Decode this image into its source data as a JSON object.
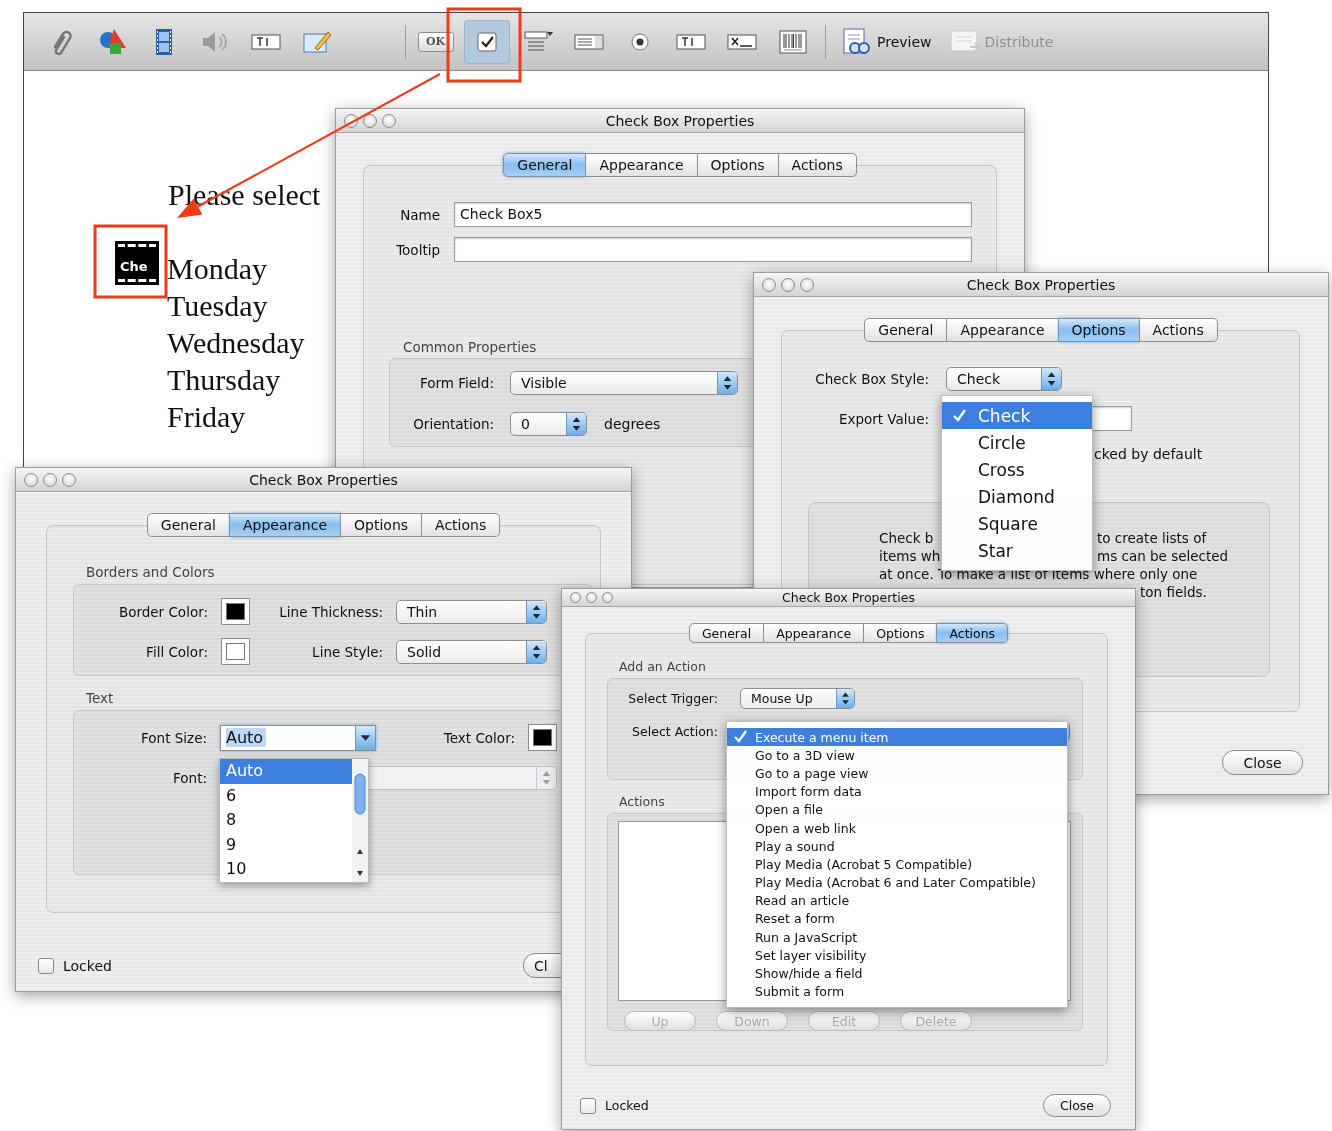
{
  "toolbar": {
    "tool_groups": [
      {
        "tools": [
          {
            "selected": false
          },
          {
            "selected": false
          },
          {
            "selected": false
          },
          {
            "selected": false
          },
          {
            "selected": false
          },
          {
            "selected": false
          }
        ]
      },
      {
        "tools": [
          {
            "label": "OK",
            "selected": false
          },
          {
            "selected": true
          },
          {
            "selected": false
          },
          {
            "selected": false
          },
          {
            "selected": false
          },
          {
            "selected": false
          },
          {
            "selected": false
          },
          {
            "selected": false
          }
        ]
      }
    ],
    "buttons": [
      {
        "label": "Preview",
        "disabled": false
      },
      {
        "label": "Distribute",
        "disabled": true
      }
    ]
  },
  "document": {
    "prompt": "Please select",
    "field_label": "Che",
    "days": [
      "Monday",
      "Tuesday",
      "Wednesday",
      "Thursday",
      "Friday"
    ]
  },
  "windows": [
    {
      "kind": "general",
      "title": "Check Box Properties",
      "tabs": [
        {
          "label": "General",
          "selected": true
        },
        {
          "label": "Appearance",
          "selected": false
        },
        {
          "label": "Options",
          "selected": false
        },
        {
          "label": "Actions",
          "selected": false
        }
      ],
      "name_label": "Name",
      "name_value": "Check Box5",
      "tooltip_label": "Tooltip",
      "common": {
        "title": "Common Properties",
        "form_field_label": "Form Field:",
        "form_field_value": "Visible",
        "orientation_label": "Orientation:",
        "orientation_value": "0",
        "orientation_unit": "degrees"
      }
    },
    {
      "kind": "options",
      "title": "Check Box Properties",
      "tabs": [
        {
          "label": "General",
          "selected": false
        },
        {
          "label": "Appearance",
          "selected": false
        },
        {
          "label": "Options",
          "selected": true
        },
        {
          "label": "Actions",
          "selected": false
        }
      ],
      "style_label": "Check Box Style:",
      "style_value": "Check",
      "export_label": "Export Value:",
      "default_text": "cked by default",
      "description_lines": [
        {
          "left": "Check b",
          "right": "to create lists of"
        },
        {
          "left": "items wh",
          "right": "ms can be selected"
        },
        {
          "full": "at once. To make a list of items where only one"
        },
        {
          "right": "ton fields."
        }
      ],
      "close_button": "Close",
      "style_menu": [
        {
          "label": "Check",
          "selected": true
        },
        {
          "label": "Circle",
          "selected": false
        },
        {
          "label": "Cross",
          "selected": false
        },
        {
          "label": "Diamond",
          "selected": false
        },
        {
          "label": "Square",
          "selected": false
        },
        {
          "label": "Star",
          "selected": false
        }
      ]
    },
    {
      "kind": "appearance",
      "title": "Check Box Properties",
      "tabs": [
        {
          "label": "General",
          "selected": false
        },
        {
          "label": "Appearance",
          "selected": true
        },
        {
          "label": "Options",
          "selected": false
        },
        {
          "label": "Actions",
          "selected": false
        }
      ],
      "borders": {
        "title": "Borders and Colors",
        "border_color_label": "Border Color:",
        "border_swatch": {
          "color": "#000000"
        },
        "line_thickness_label": "Line Thickness:",
        "line_thickness_value": "Thin",
        "fill_color_label": "Fill Color:",
        "fill_swatch": {
          "color": "#ffffff"
        },
        "line_style_label": "Line Style:",
        "line_style_value": "Solid"
      },
      "text": {
        "title": "Text",
        "font_size_label": "Font Size:",
        "font_size_value": "Auto",
        "text_color_label": "Text Color:",
        "text_swatch": {
          "color": "#000000"
        },
        "font_label": "Font:"
      },
      "font_size_menu": [
        {
          "label": "Auto",
          "selected": true
        },
        {
          "label": "6",
          "selected": false
        },
        {
          "label": "8",
          "selected": false
        },
        {
          "label": "9",
          "selected": false
        },
        {
          "label": "10",
          "selected": false
        }
      ],
      "locked": {
        "label": "Locked",
        "checked": false
      },
      "close_button": "Cl"
    },
    {
      "kind": "actions",
      "title": "Check Box Properties",
      "tabs": [
        {
          "label": "General",
          "selected": false
        },
        {
          "label": "Appearance",
          "selected": false
        },
        {
          "label": "Options",
          "selected": false
        },
        {
          "label": "Actions",
          "selected": true
        }
      ],
      "add": {
        "title": "Add an Action",
        "trigger_label": "Select Trigger:",
        "trigger_value": "Mouse Up",
        "action_label": "Select Action:"
      },
      "action_menu": [
        {
          "label": "Execute a menu item",
          "selected": true
        },
        {
          "label": "Go to a 3D view",
          "selected": false
        },
        {
          "label": "Go to a page view",
          "selected": false
        },
        {
          "label": "Import form data",
          "selected": false
        },
        {
          "label": "Open a file",
          "selected": false
        },
        {
          "label": "Open a web link",
          "selected": false
        },
        {
          "label": "Play a sound",
          "selected": false
        },
        {
          "label": "Play Media (Acrobat 5 Compatible)",
          "selected": false
        },
        {
          "label": "Play Media (Acrobat 6 and Later Compatible)",
          "selected": false
        },
        {
          "label": "Read an article",
          "selected": false
        },
        {
          "label": "Reset a form",
          "selected": false
        },
        {
          "label": "Run a JavaScript",
          "selected": false
        },
        {
          "label": "Set layer visibility",
          "selected": false
        },
        {
          "label": "Show/hide a field",
          "selected": false
        },
        {
          "label": "Submit a form",
          "selected": false
        }
      ],
      "actions_group": {
        "title": "Actions",
        "buttons": [
          {
            "label": "Up",
            "disabled": true
          },
          {
            "label": "Down",
            "disabled": true
          },
          {
            "label": "Edit",
            "disabled": true
          },
          {
            "label": "Delete",
            "disabled": true
          }
        ]
      },
      "locked": {
        "label": "Locked",
        "checked": false
      },
      "close_button": "Close"
    }
  ]
}
